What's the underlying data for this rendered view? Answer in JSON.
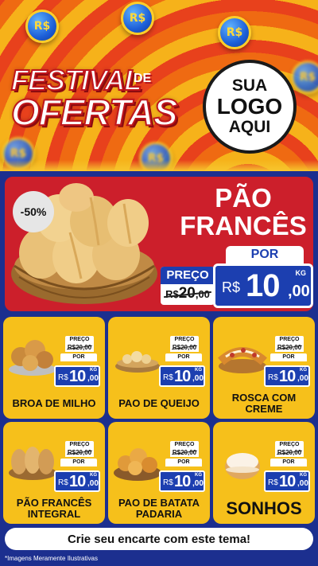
{
  "header": {
    "coin_symbol": "R$",
    "festival_line1": "FESTIVAL",
    "festival_de": "DE",
    "festival_line2": "OFERTAS",
    "logo_line1": "SUA",
    "logo_line2": "LOGO",
    "logo_line3": "AQUI"
  },
  "hero": {
    "discount": "-50%",
    "title_line1": "PÃO",
    "title_line2": "FRANCÊS",
    "preco_label": "PREÇO",
    "old_price_currency": "R$",
    "old_price_int": "20",
    "old_price_dec": ",00",
    "por_label": "POR",
    "currency": "R$",
    "price_int": "10",
    "price_dec": ",00",
    "unit": "KG"
  },
  "products": [
    {
      "name": "BROA DE MILHO",
      "preco_label": "PREÇO",
      "old_price": "R$20,00",
      "por_label": "POR",
      "currency": "R$",
      "price_int": "10",
      "price_dec": ",00",
      "unit": "KG"
    },
    {
      "name": "PAO DE QUEIJO",
      "preco_label": "PREÇO",
      "old_price": "R$20,00",
      "por_label": "POR",
      "currency": "R$",
      "price_int": "10",
      "price_dec": ",00",
      "unit": "KG"
    },
    {
      "name": "ROSCA COM CREME",
      "preco_label": "PREÇO",
      "old_price": "R$20,00",
      "por_label": "POR",
      "currency": "R$",
      "price_int": "10",
      "price_dec": ",00",
      "unit": "KG"
    },
    {
      "name": "PÃO FRANCÊS INTEGRAL",
      "preco_label": "PREÇO",
      "old_price": "R$20,00",
      "por_label": "POR",
      "currency": "R$",
      "price_int": "10",
      "price_dec": ",00",
      "unit": "KG"
    },
    {
      "name": "PAO DE BATATA PADARIA",
      "preco_label": "PREÇO",
      "old_price": "R$20,00",
      "por_label": "POR",
      "currency": "R$",
      "price_int": "10",
      "price_dec": ",00",
      "unit": "KG"
    },
    {
      "name": "SONHOS",
      "preco_label": "PREÇO",
      "old_price": "R$20,00",
      "por_label": "POR",
      "currency": "R$",
      "price_int": "10",
      "price_dec": ",00",
      "unit": "KG"
    }
  ],
  "footer": {
    "cta": "Crie seu encarte com este tema!",
    "disclaimer": "*Imagens Meramente Ilustrativas"
  },
  "colors": {
    "accent_blue": "#1c3fb0",
    "hero_red": "#cc1f2b",
    "card_yellow": "#f6c01b"
  }
}
